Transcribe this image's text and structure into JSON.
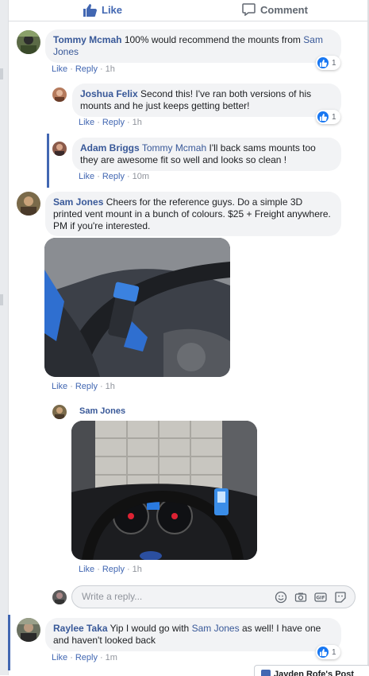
{
  "actions": {
    "like_label": "Like",
    "comment_label": "Comment"
  },
  "comments": [
    {
      "name": "Tommy Mcmah",
      "text": "100% would recommend the mounts from ",
      "mention": "Sam Jones",
      "text_after": "",
      "like": "Like",
      "reply": "Reply",
      "time": "1h",
      "reactions": "1"
    },
    {
      "name": "Joshua Felix",
      "text": "Second this! I've ran both versions of his mounts and he just keeps getting better!",
      "like": "Like",
      "reply": "Reply",
      "time": "1h",
      "reactions": "1"
    },
    {
      "name": "Adam Briggs",
      "mention": "Tommy Mcmah",
      "text": "I'll back sams mounts too they are awesome fit so well and looks so clean !",
      "like": "Like",
      "reply": "Reply",
      "time": "10m"
    },
    {
      "name": "Sam Jones",
      "text": "Cheers for the reference guys. Do a simple 3D printed vent mount in a bunch of colours. $25 + Freight anywhere. PM if you're interested.",
      "like": "Like",
      "reply": "Reply",
      "time": "1h"
    },
    {
      "name": "Sam Jones",
      "like": "Like",
      "reply": "Reply",
      "time": "1h"
    },
    {
      "name": "Raylee Taka",
      "text": "Yip I would go with ",
      "mention": "Sam Jones",
      "text_after": " as well! I have one and haven't looked back",
      "like": "Like",
      "reply": "Reply",
      "time": "1m",
      "reactions": "1"
    }
  ],
  "reply_box": {
    "placeholder": "Write a reply..."
  },
  "chat_tab": {
    "label": "Jayden Rofe's Post"
  },
  "colors": {
    "accent": "#4267b2",
    "link": "#385898",
    "bubble": "#f2f3f5",
    "like_blue": "#1877f2"
  }
}
